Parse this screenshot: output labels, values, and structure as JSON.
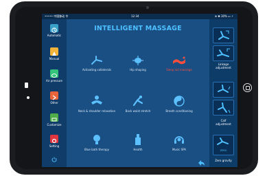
{
  "status_bar": {
    "carrier": "••••• 中国移动 令",
    "time": "12:34",
    "battery": "⊕ ✱ 30% ▭ ⚡"
  },
  "header": {
    "title": "INTELLIGENT MASSAGE"
  },
  "sidebar": {
    "items": [
      {
        "label": "Automatic",
        "icon": "automatic-icon",
        "color": "#3aa0c8"
      },
      {
        "label": "Manual",
        "icon": "manual-icon",
        "color": "#f2b33a"
      },
      {
        "label": "Air pressure",
        "icon": "air-pressure-icon",
        "color": "#35c27a"
      },
      {
        "label": "Other",
        "icon": "other-icon",
        "color": "#e8643a"
      },
      {
        "label": "Customize",
        "icon": "customize-icon",
        "color": "#4fae4a"
      },
      {
        "label": "Setting",
        "icon": "setting-icon",
        "color": "#e0363f"
      },
      {
        "label": "",
        "icon": "power-icon",
        "color": "#4fc0ff"
      }
    ]
  },
  "programs": [
    {
      "label": "Activating collaterals",
      "icon": "activating-collaterals-icon",
      "active": false
    },
    {
      "label": "Hip shaping",
      "icon": "hip-shaping-icon",
      "active": false
    },
    {
      "label": "Sleep aid massage",
      "icon": "sleep-aid-massage-icon",
      "active": true
    },
    {
      "label": "Neck & shoulder relaxation",
      "icon": "neck-shoulder-relaxation-icon",
      "active": false
    },
    {
      "label": "Back waist stretch",
      "icon": "back-waist-stretch-icon",
      "active": false
    },
    {
      "label": "Breath conditioning",
      "icon": "breath-conditioning-icon",
      "active": false
    },
    {
      "label": "Blue bath therapy",
      "icon": "blue-bath-therapy-icon",
      "active": false
    },
    {
      "label": "Health",
      "icon": "health-icon",
      "active": false
    },
    {
      "label": "Music SPA",
      "icon": "music-spa-icon",
      "active": false
    }
  ],
  "right_panel": {
    "leg_lift_label": "Linkage",
    "leg_lift_sub": "adjustment",
    "calf_label": "Calf",
    "calf_sub": "adjustment",
    "zero_gravity_label": "Zero gravity",
    "zero_gravity_badge": "ZERO"
  },
  "colors": {
    "accent": "#4fc0ff",
    "active": "#ff4f3c",
    "screen_bg": "#1a4f84"
  }
}
